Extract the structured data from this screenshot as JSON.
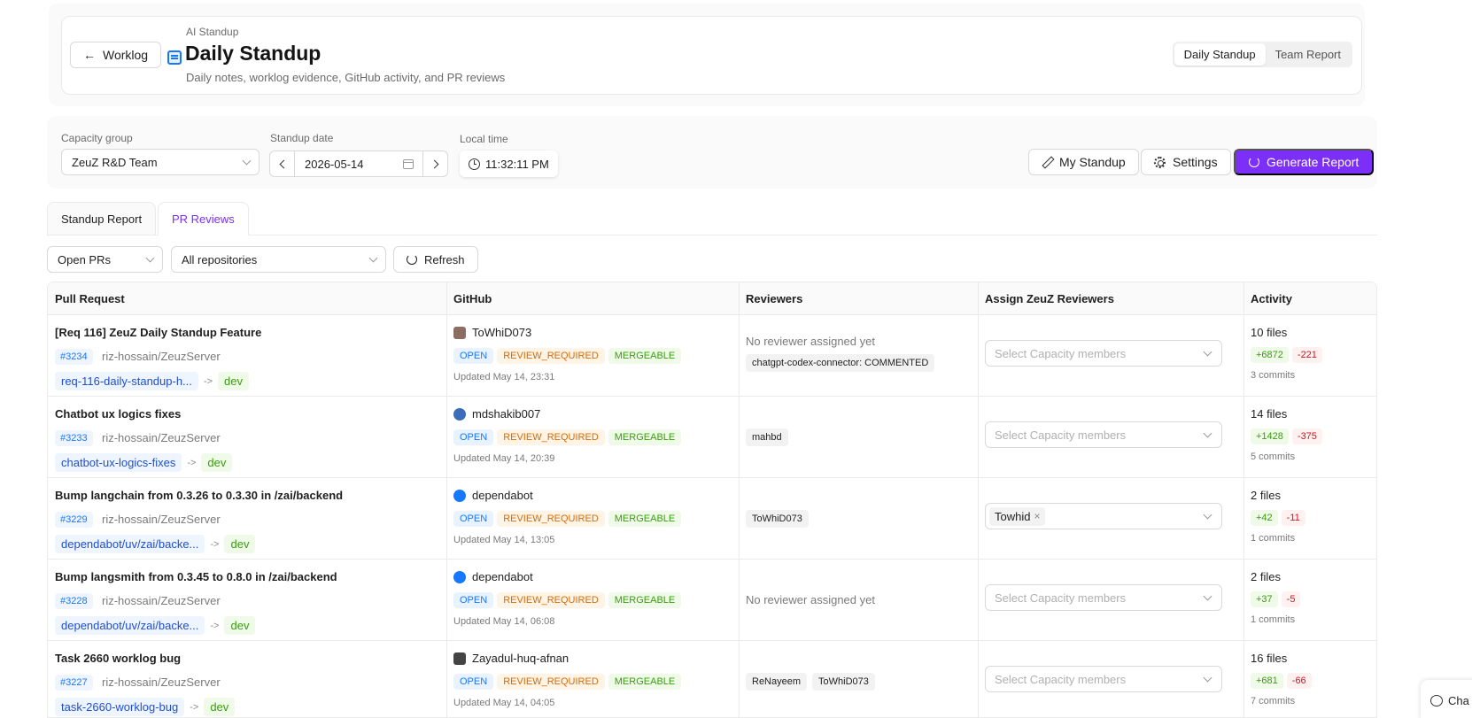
{
  "header": {
    "back_label": "Worklog",
    "eyebrow": "AI Standup",
    "title": "Daily Standup",
    "subtitle": "Daily notes, worklog evidence, GitHub activity, and PR reviews",
    "view_switch": [
      "Daily Standup",
      "Team Report"
    ],
    "view_selected": "Daily Standup"
  },
  "filters": {
    "capacity_label": "Capacity group",
    "capacity_value": "ZeuZ R&D Team",
    "date_label": "Standup date",
    "date_value": "2026-05-14",
    "time_label": "Local time",
    "time_value": "11:32:11 PM",
    "my_standup": "My Standup",
    "settings": "Settings",
    "generate": "Generate Report"
  },
  "tabs": [
    "Standup Report",
    "PR Reviews"
  ],
  "active_tab": "PR Reviews",
  "pr_filters": {
    "state": "Open PRs",
    "repo": "All repositories",
    "refresh": "Refresh"
  },
  "table": {
    "headers": [
      "Pull Request",
      "GitHub",
      "Reviewers",
      "Assign ZeuZ Reviewers",
      "Activity"
    ],
    "assign_placeholder": "Select Capacity members",
    "rows": [
      {
        "title": "[Req 116] ZeuZ Daily Standup Feature",
        "number": "#3234",
        "repo": "riz-hossain/ZeuzServer",
        "branch": "req-116-daily-standup-h...",
        "arrow": "->",
        "target": "dev",
        "author": "ToWhiD073",
        "tags": [
          "OPEN",
          "REVIEW_REQUIRED",
          "MERGEABLE"
        ],
        "updated": "Updated May 14, 23:31",
        "reviewer_note": "No reviewer assigned yet",
        "reviewers": [
          "chatgpt-codex-connector: COMMENTED"
        ],
        "assigned": "",
        "files": "10 files",
        "additions": "+6872",
        "deletions": "-221",
        "commits": "3 commits"
      },
      {
        "title": "Chatbot ux logics fixes",
        "number": "#3233",
        "repo": "riz-hossain/ZeuzServer",
        "branch": "chatbot-ux-logics-fixes",
        "arrow": "->",
        "target": "dev",
        "author": "mdshakib007",
        "tags": [
          "OPEN",
          "REVIEW_REQUIRED",
          "MERGEABLE"
        ],
        "updated": "Updated May 14, 20:39",
        "reviewer_note": "",
        "reviewers": [
          "mahbd"
        ],
        "assigned": "",
        "files": "14 files",
        "additions": "+1428",
        "deletions": "-375",
        "commits": "5 commits"
      },
      {
        "title": "Bump langchain from 0.3.26 to 0.3.30 in /zai/backend",
        "number": "#3229",
        "repo": "riz-hossain/ZeuzServer",
        "branch": "dependabot/uv/zai/backe...",
        "arrow": "->",
        "target": "dev",
        "author": "dependabot",
        "tags": [
          "OPEN",
          "REVIEW_REQUIRED",
          "MERGEABLE"
        ],
        "updated": "Updated May 14, 13:05",
        "reviewer_note": "",
        "reviewers": [
          "ToWhiD073"
        ],
        "assigned": "Towhid",
        "files": "2 files",
        "additions": "+42",
        "deletions": "-11",
        "commits": "1 commits"
      },
      {
        "title": "Bump langsmith from 0.3.45 to 0.8.0 in /zai/backend",
        "number": "#3228",
        "repo": "riz-hossain/ZeuzServer",
        "branch": "dependabot/uv/zai/backe...",
        "arrow": "->",
        "target": "dev",
        "author": "dependabot",
        "tags": [
          "OPEN",
          "REVIEW_REQUIRED",
          "MERGEABLE"
        ],
        "updated": "Updated May 14, 06:08",
        "reviewer_note": "No reviewer assigned yet",
        "reviewers": [],
        "assigned": "",
        "files": "2 files",
        "additions": "+37",
        "deletions": "-5",
        "commits": "1 commits"
      },
      {
        "title": "Task 2660 worklog bug",
        "number": "#3227",
        "repo": "riz-hossain/ZeuzServer",
        "branch": "task-2660-worklog-bug",
        "arrow": "->",
        "target": "dev",
        "author": "Zayadul-huq-afnan",
        "tags": [
          "OPEN",
          "REVIEW_REQUIRED",
          "MERGEABLE"
        ],
        "updated": "Updated May 14, 04:05",
        "reviewer_note": "",
        "reviewers": [
          "ReNayeem",
          "ToWhiD073"
        ],
        "assigned": "",
        "files": "16 files",
        "additions": "+681",
        "deletions": "-66",
        "commits": "7 commits"
      }
    ]
  },
  "chat": {
    "label": "Cha"
  },
  "colors": {
    "accent": "#7b2ff7",
    "link": "#1677ff"
  }
}
